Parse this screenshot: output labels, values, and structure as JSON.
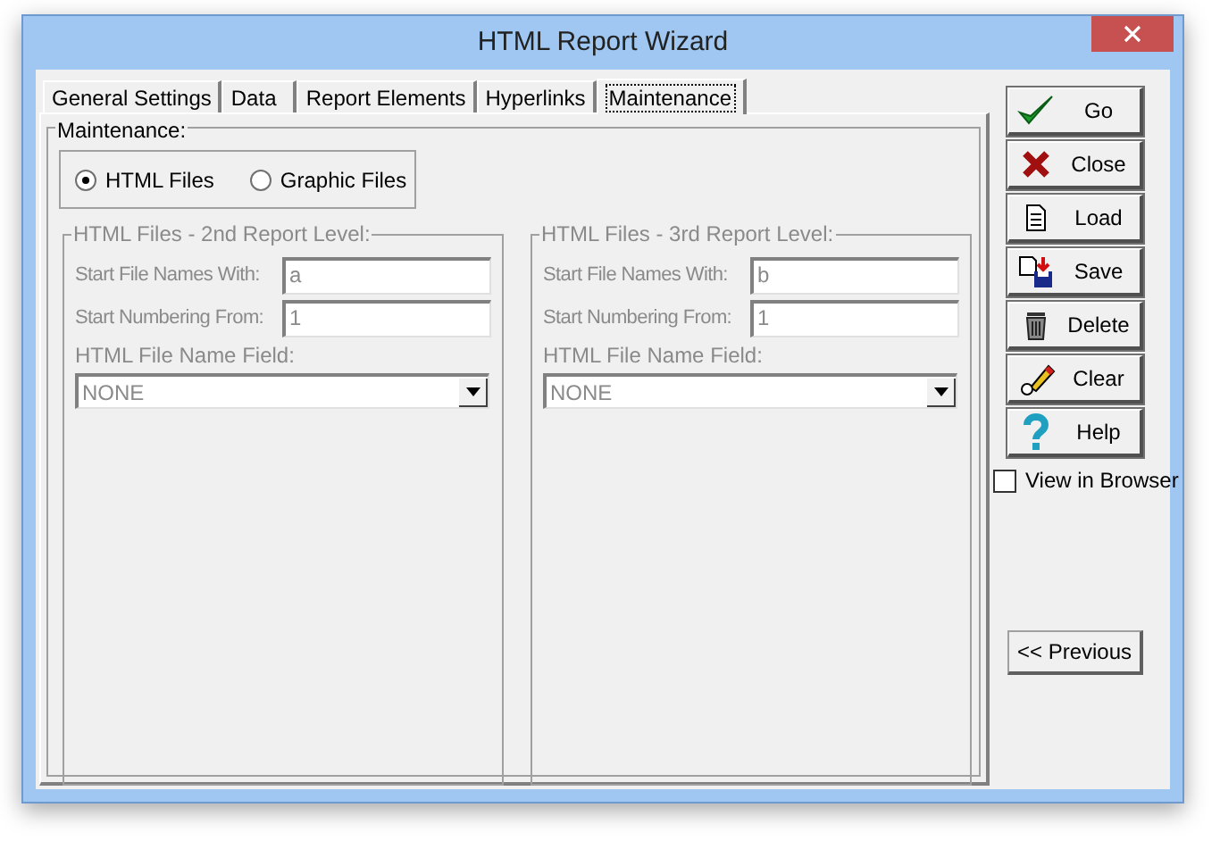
{
  "window": {
    "title": "HTML Report Wizard"
  },
  "tabs": [
    {
      "label": "General Settings",
      "selected": false
    },
    {
      "label": "Data",
      "selected": false
    },
    {
      "label": "Report Elements",
      "selected": false
    },
    {
      "label": "Hyperlinks",
      "selected": false
    },
    {
      "label": "Maintenance",
      "selected": true
    }
  ],
  "maintenance": {
    "title": "Maintenance:",
    "file_type": [
      {
        "label": "HTML Files",
        "selected": true
      },
      {
        "label": "Graphic Files",
        "selected": false
      }
    ],
    "levels": [
      {
        "title": "HTML Files - 2nd Report Level:",
        "disabled": true,
        "start_names_label": "Start File Names With:",
        "start_names_value": "a",
        "start_number_label": "Start Numbering From:",
        "start_number_value": "1",
        "name_field_label": "HTML File Name Field:",
        "name_field_value": "NONE"
      },
      {
        "title": "HTML Files - 3rd Report Level:",
        "disabled": true,
        "start_names_label": "Start File Names With:",
        "start_names_value": "b",
        "start_number_label": "Start Numbering From:",
        "start_number_value": "1",
        "name_field_label": "HTML File Name Field:",
        "name_field_value": "NONE"
      }
    ]
  },
  "buttons": [
    {
      "label": "Go",
      "kind": "go"
    },
    {
      "label": "Close",
      "kind": "close"
    },
    {
      "label": "Load",
      "kind": "load"
    },
    {
      "label": "Save",
      "kind": "save"
    },
    {
      "label": "Delete",
      "kind": "delete"
    },
    {
      "label": "Clear",
      "kind": "clear"
    },
    {
      "label": "Help",
      "kind": "help"
    }
  ],
  "view_in_browser": {
    "label": "View in Browser",
    "checked": false
  },
  "previous_button": {
    "label": "<< Previous"
  }
}
